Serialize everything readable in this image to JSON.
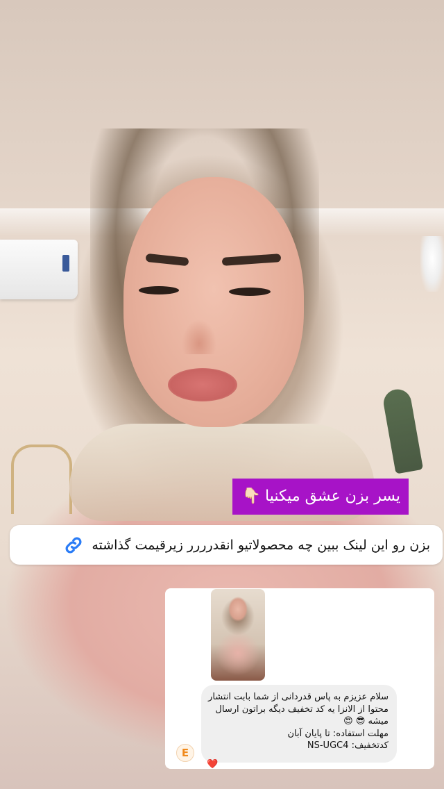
{
  "story": {
    "caption_purple": "یسر بزن عشق میکنیا",
    "caption_emoji": "👇🏻",
    "link_sticker_text": "بزن رو این لینک ببین چه محصولاتیو انقدرررر زیرقیمت گذاشته",
    "link_icon": "link-icon",
    "colors": {
      "caption_bg": "#a713c7",
      "link_icon": "#2a7cf6"
    }
  },
  "dm": {
    "message_lines": [
      "سلام عزیزم به پاس قدردانی از شما بابت انتشار",
      "محتوا از الانزا یه کد تخفیف دیگه براتون ارسال",
      "میشه 😎 😍",
      "مهلت استفاده: تا پایان آبان",
      "کدتخفیف: NS-UGC4"
    ],
    "avatar_letter": "E",
    "reaction": "❤️"
  }
}
